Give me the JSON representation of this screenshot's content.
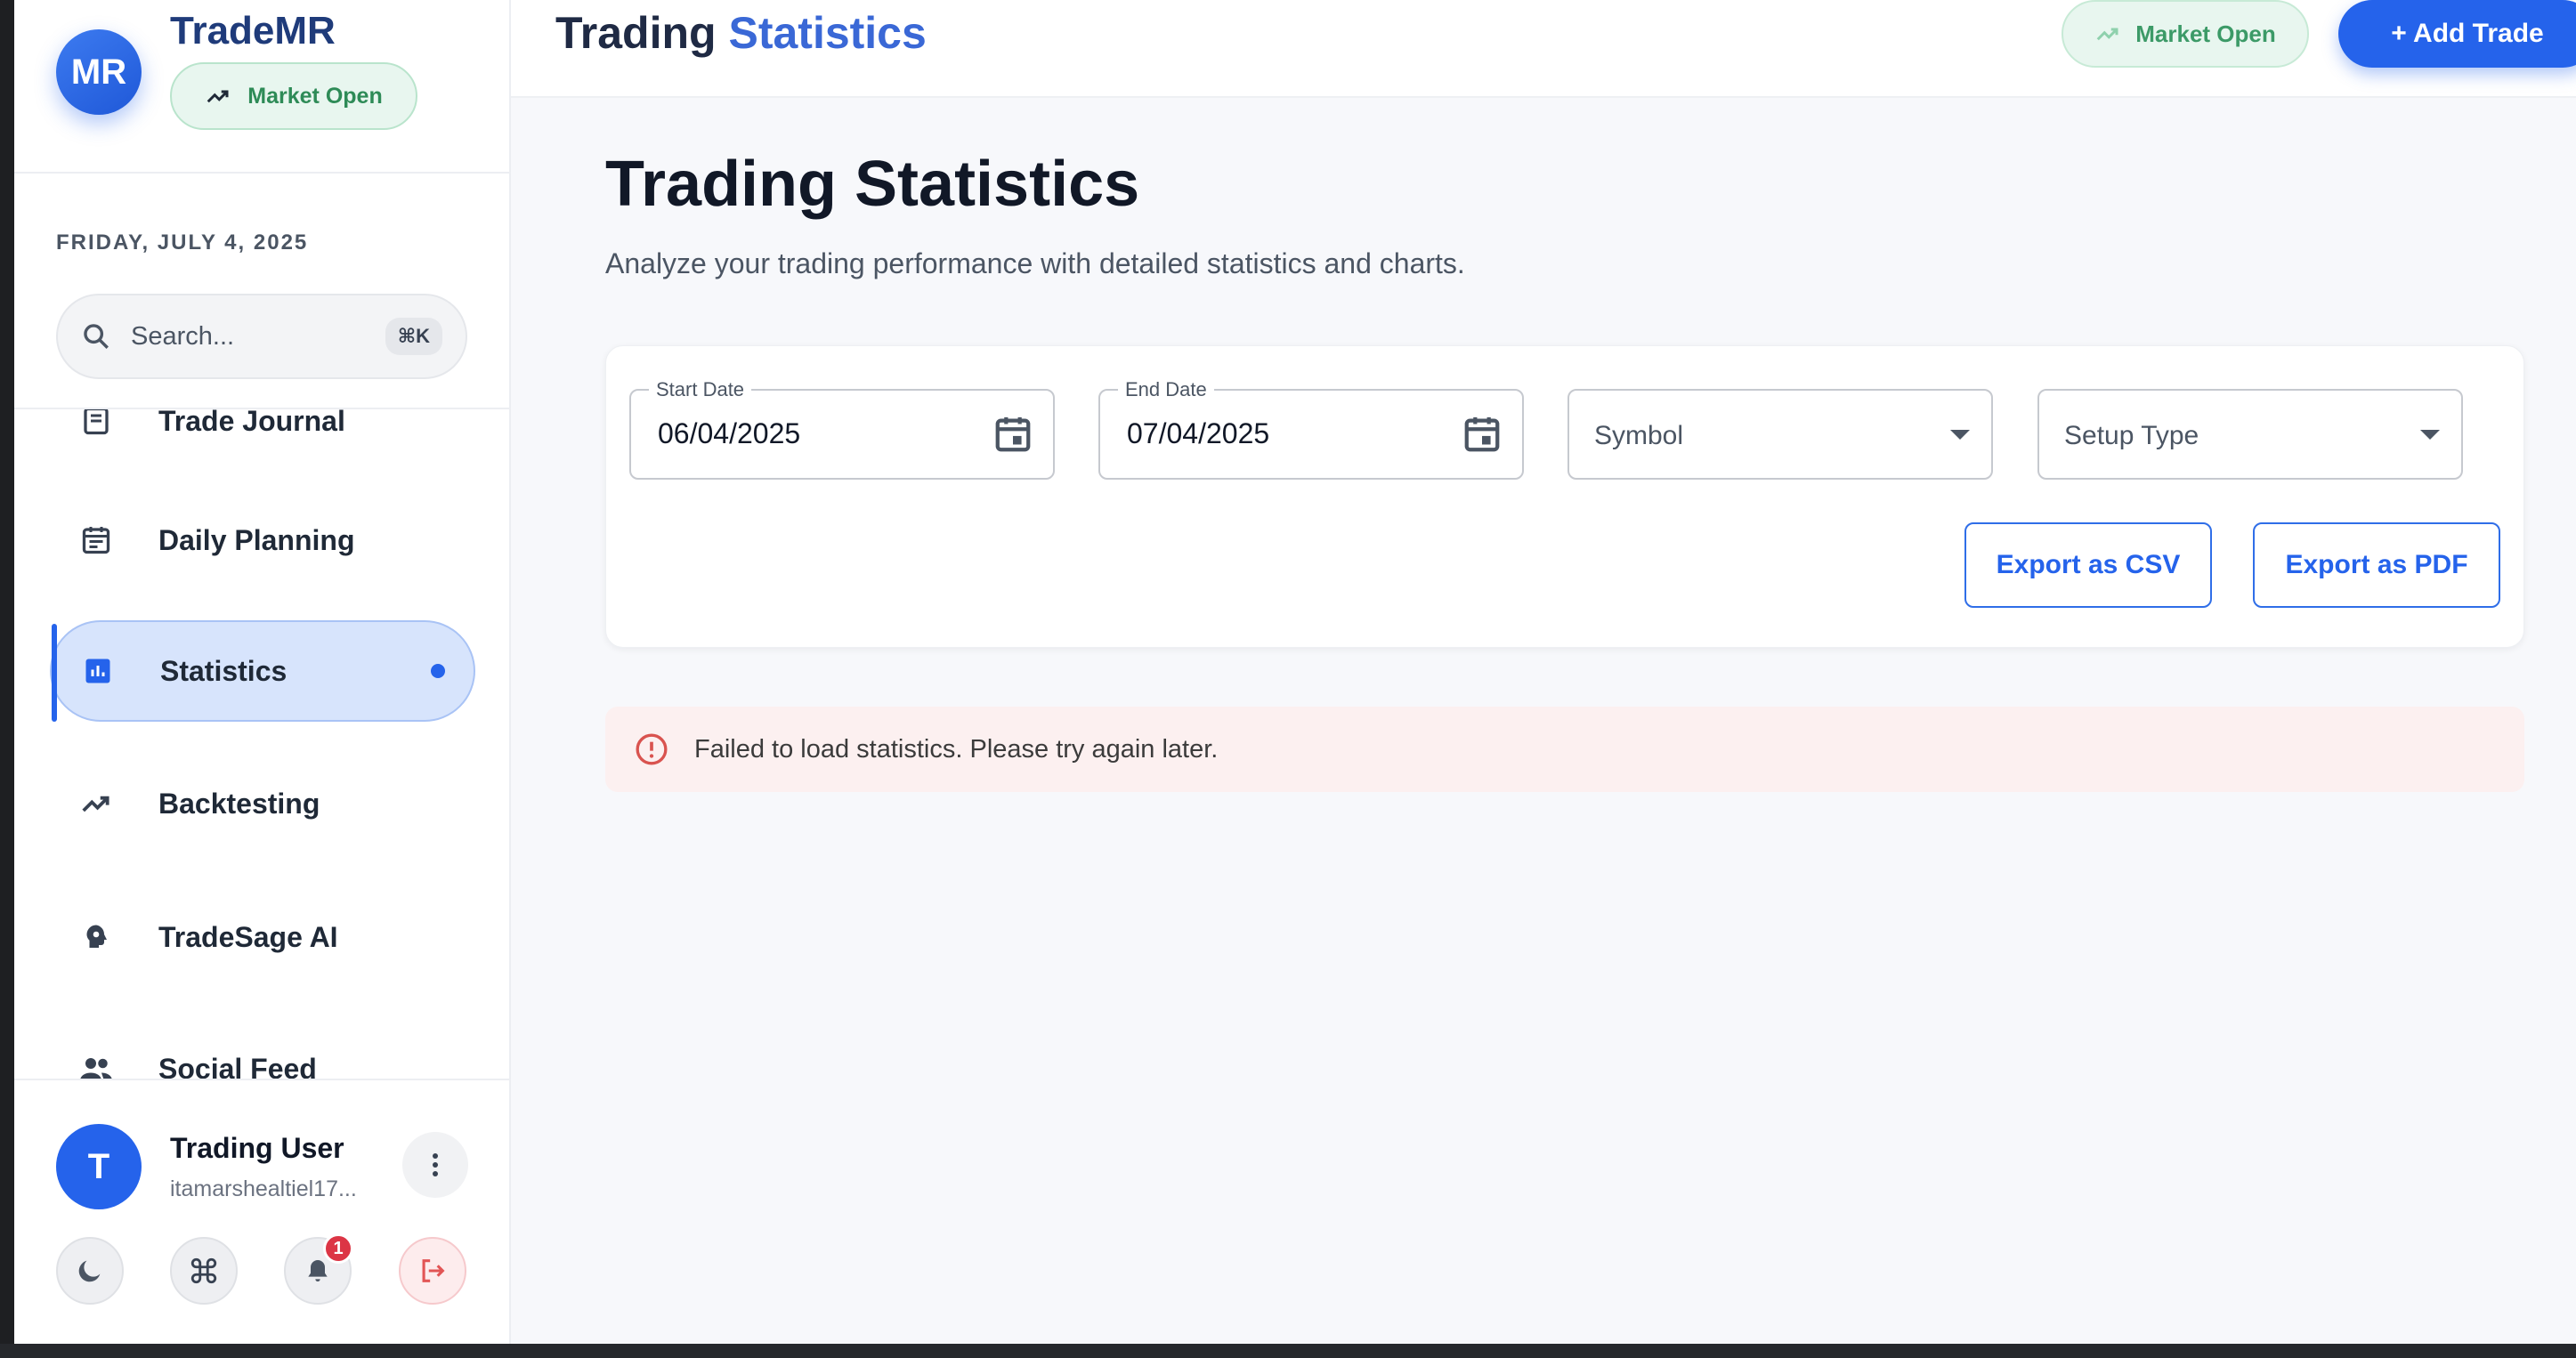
{
  "brand": {
    "logo_initials": "MR",
    "name": "TradeMR",
    "status": "Market Open"
  },
  "sidebar": {
    "date": "FRIDAY, JULY 4, 2025",
    "search": {
      "placeholder": "Search...",
      "shortcut": "⌘K"
    },
    "items": [
      {
        "label": "Trade Journal",
        "icon": "journal-icon"
      },
      {
        "label": "Daily Planning",
        "icon": "calendar-icon"
      },
      {
        "label": "Statistics",
        "icon": "bar-chart-icon",
        "active": true
      },
      {
        "label": "Backtesting",
        "icon": "trending-up-icon"
      },
      {
        "label": "TradeSage AI",
        "icon": "brain-icon"
      },
      {
        "label": "Social Feed",
        "icon": "people-icon"
      }
    ],
    "user": {
      "initial": "T",
      "name": "Trading User",
      "email": "itamarshealtiel17..."
    },
    "footer_buttons": [
      "moon-icon",
      "command-icon",
      "bell-icon",
      "logout-icon"
    ],
    "notification_count": "1"
  },
  "header": {
    "title_part1": "Trading",
    "title_part2": "Statistics",
    "market_status": "Market Open",
    "add_trade_label": "+ Add Trade"
  },
  "main": {
    "title": "Trading Statistics",
    "subtitle": "Analyze your trading performance with detailed statistics and charts.",
    "filters": {
      "start_date": {
        "label": "Start Date",
        "value": "06/04/2025"
      },
      "end_date": {
        "label": "End Date",
        "value": "07/04/2025"
      },
      "symbol": {
        "placeholder": "Symbol"
      },
      "setup_type": {
        "placeholder": "Setup Type"
      }
    },
    "export_csv": "Export as CSV",
    "export_pdf": "Export as PDF",
    "error": "Failed to load statistics. Please try again later."
  },
  "colors": {
    "accent": "#2563eb",
    "success": "#2e8b57",
    "error": "#dc3545"
  }
}
